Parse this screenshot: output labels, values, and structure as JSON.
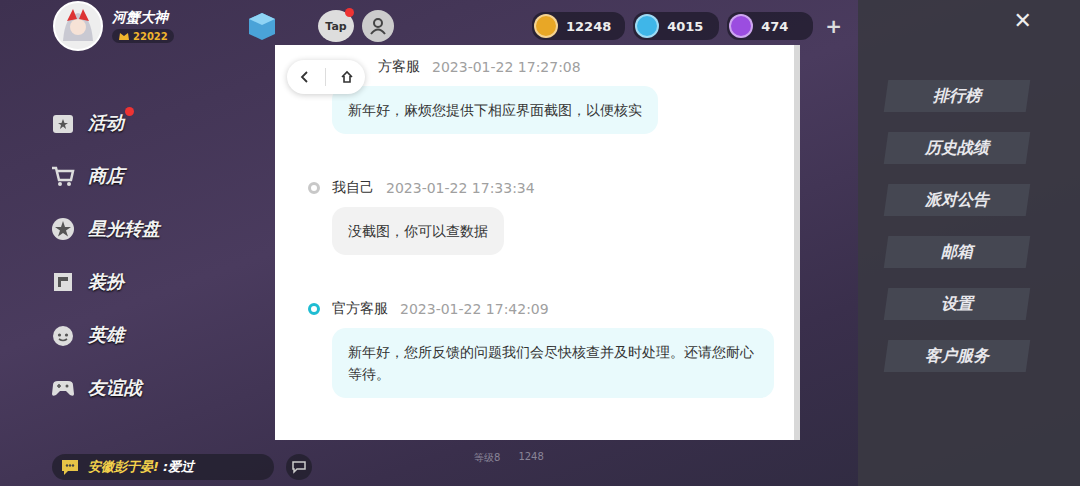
{
  "player": {
    "name": "河蟹大神",
    "level": "22022"
  },
  "top_icons": {
    "tap_label": "Tap",
    "tap_badge": true
  },
  "currencies": [
    {
      "kind": "coin",
      "amount": "12248",
      "color": "#e8a726"
    },
    {
      "kind": "gem",
      "amount": "4015",
      "color": "#3fb6e8"
    },
    {
      "kind": "token",
      "amount": "474",
      "color": "#9b4de0"
    }
  ],
  "add_button": "+",
  "close_button": "✕",
  "menu": [
    {
      "label": "活动",
      "badge": true
    },
    {
      "label": "商店",
      "badge": false
    },
    {
      "label": "星光转盘",
      "badge": false
    },
    {
      "label": "装扮",
      "badge": false
    },
    {
      "label": "英雄",
      "badge": false
    },
    {
      "label": "友谊战",
      "badge": false
    }
  ],
  "side_buttons": [
    "排行榜",
    "历史战绩",
    "派对公告",
    "邮箱",
    "设置",
    "客户服务"
  ],
  "chat": {
    "name": "安徽彭于晏!",
    "message": ":爱过"
  },
  "behind_dialog": {
    "level": "等级8",
    "score": "1248"
  },
  "dialog": {
    "messages": [
      {
        "kind": "official",
        "sender": "方客服",
        "time": "2023-01-22 17:27:08",
        "text": "新年好，麻烦您提供下相应界面截图，以便核实"
      },
      {
        "kind": "self",
        "sender": "我自己",
        "time": "2023-01-22 17:33:34",
        "text": "没截图，你可以查数据"
      },
      {
        "kind": "official",
        "sender": "官方客服",
        "time": "2023-01-22 17:42:09",
        "text": "新年好，您所反馈的问题我们会尽快核查并及时处理。还请您耐心等待。"
      }
    ]
  }
}
